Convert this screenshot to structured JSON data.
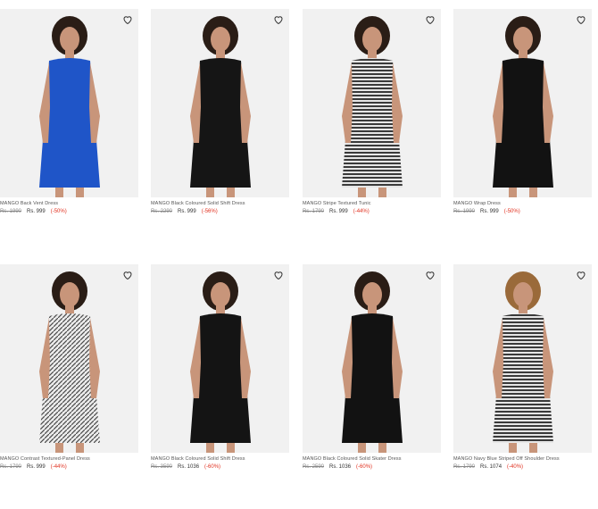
{
  "products": [
    {
      "title": "MANGO Back Vent Dress",
      "original_price": "Rs. 1990",
      "price": "Rs. 999",
      "discount": "(-50%)",
      "dress_color": "#1f55c8",
      "pattern": "solid"
    },
    {
      "title": "MANGO Black Coloured Solid Shift Dress",
      "original_price": "Rs. 2290",
      "price": "Rs. 999",
      "discount": "(-56%)",
      "dress_color": "#151515",
      "pattern": "solid"
    },
    {
      "title": "MANGO Stripe Textured Tunic",
      "original_price": "Rs. 1790",
      "price": "Rs. 999",
      "discount": "(-44%)",
      "dress_color": "#8a8a8a",
      "pattern": "stripes"
    },
    {
      "title": "MANGO Wrap Dress",
      "original_price": "Rs. 1990",
      "price": "Rs. 999",
      "discount": "(-50%)",
      "dress_color": "#121212",
      "pattern": "solid"
    },
    {
      "title": "MANGO Contrast Textured-Panel Dress",
      "original_price": "Rs. 1790",
      "price": "Rs. 999",
      "discount": "(-44%)",
      "dress_color": "#b5b5b5",
      "pattern": "texture"
    },
    {
      "title": "MANGO Black Coloured Solid Shift Dress",
      "original_price": "Rs. 3590",
      "price": "Rs. 1036",
      "discount": "(-60%)",
      "dress_color": "#141414",
      "pattern": "solid"
    },
    {
      "title": "MANGO Black Coloured Solid Skater Dress",
      "original_price": "Rs. 2590",
      "price": "Rs. 1036",
      "discount": "(-60%)",
      "dress_color": "#121212",
      "pattern": "solid"
    },
    {
      "title": "MANGO Navy Blue Striped Off Shoulder Dress",
      "original_price": "Rs. 1790",
      "price": "Rs. 1074",
      "discount": "(-40%)",
      "dress_color": "#7d7f86",
      "pattern": "stripes"
    }
  ],
  "icons": {
    "wishlist": "heart-outline-icon"
  },
  "colors": {
    "discount": "#e1301f",
    "card_bg": "#f1f1f1"
  }
}
